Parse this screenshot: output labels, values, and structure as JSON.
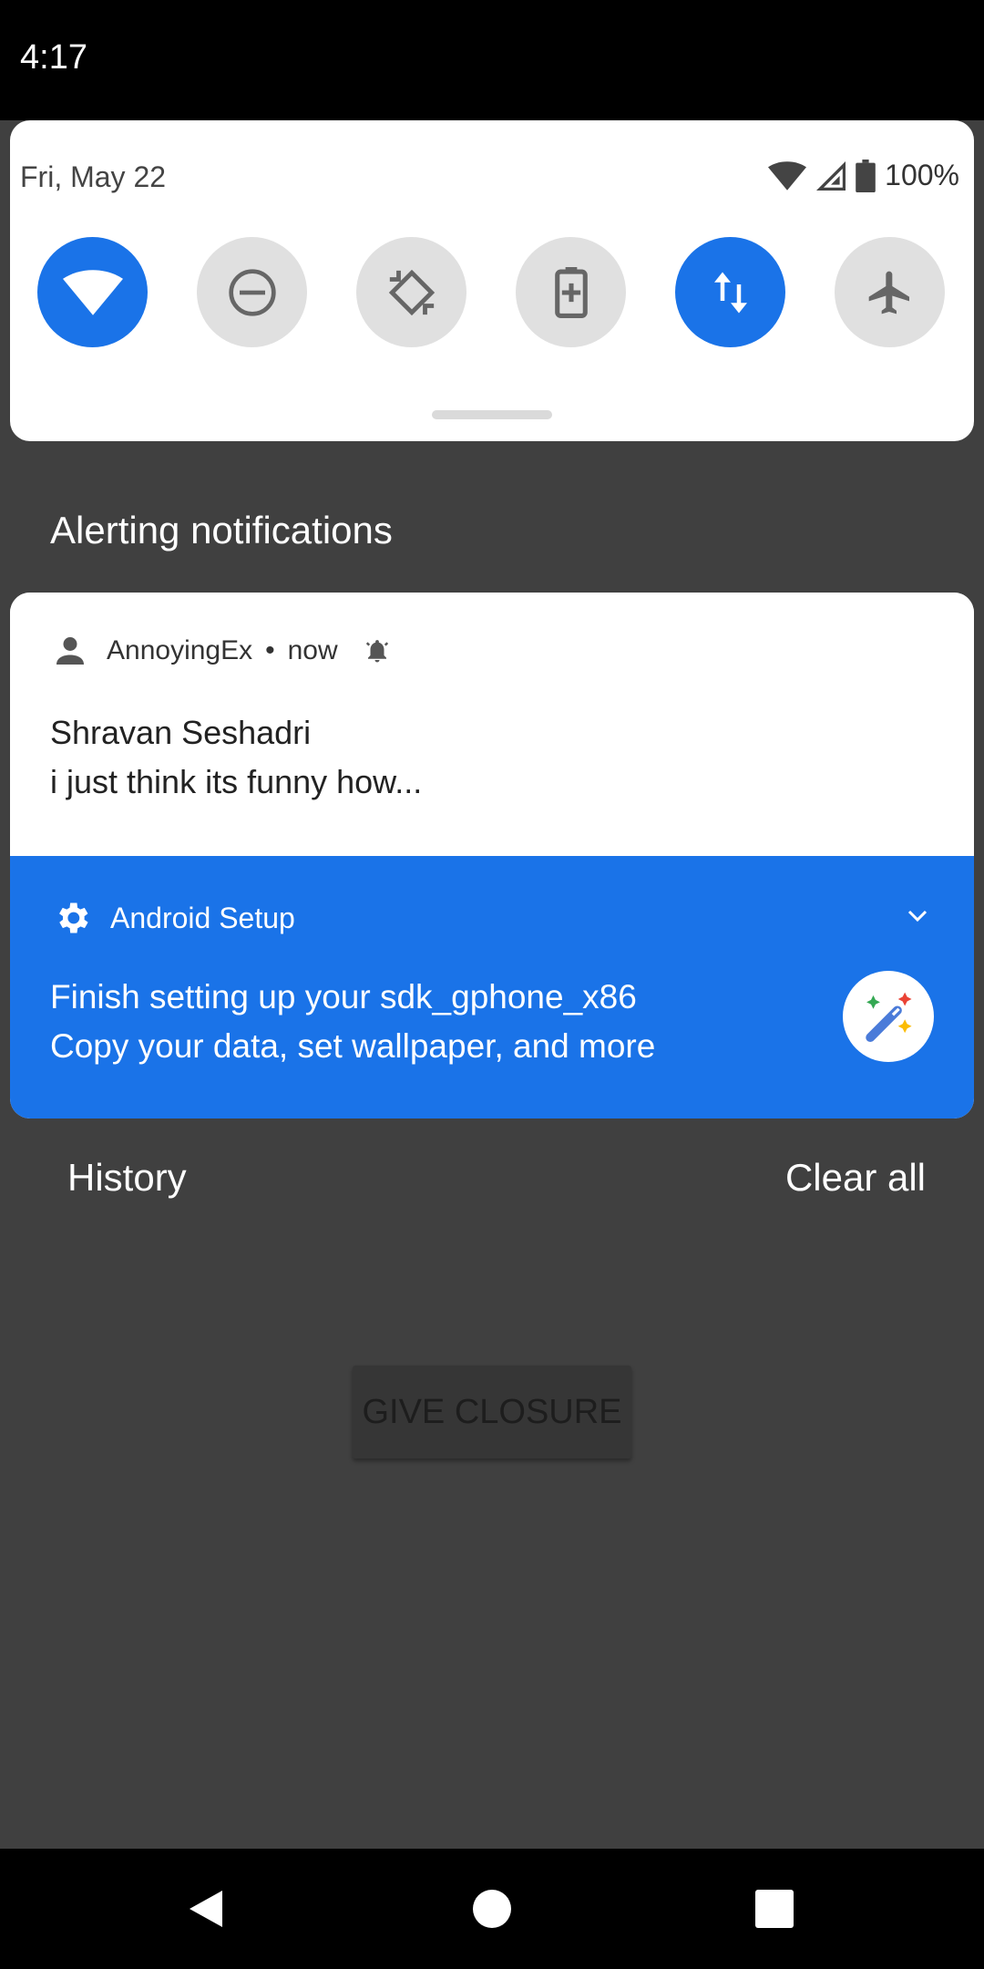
{
  "status_bar": {
    "time": "4:17"
  },
  "quick_settings": {
    "date": "Fri, May 22",
    "battery_percent": "100%",
    "tiles": [
      {
        "name": "wifi",
        "icon": "wifi-icon",
        "active": true
      },
      {
        "name": "do-not-disturb",
        "icon": "do-not-disturb-icon",
        "active": false
      },
      {
        "name": "auto-rotate",
        "icon": "auto-rotate-icon",
        "active": false
      },
      {
        "name": "battery-saver",
        "icon": "battery-saver-icon",
        "active": false
      },
      {
        "name": "mobile-data",
        "icon": "mobile-data-icon",
        "active": true
      },
      {
        "name": "airplane-mode",
        "icon": "airplane-icon",
        "active": false
      }
    ]
  },
  "section_title": "Alerting notifications",
  "notifications": [
    {
      "app": "AnnoyingEx",
      "separator": "•",
      "time": "now",
      "title": "Shravan Seshadri",
      "text": "i just think its funny how..."
    },
    {
      "app": "Android Setup",
      "title": "Finish setting up your sdk_gphone_x86",
      "text": "Copy your data, set wallpaper, and more"
    }
  ],
  "footer": {
    "history": "History",
    "clear_all": "Clear all"
  },
  "app_button": "GIVE CLOSURE",
  "colors": {
    "accent": "#1a73e8",
    "scrim": "#404040",
    "tile_off": "#e0e0e0"
  }
}
